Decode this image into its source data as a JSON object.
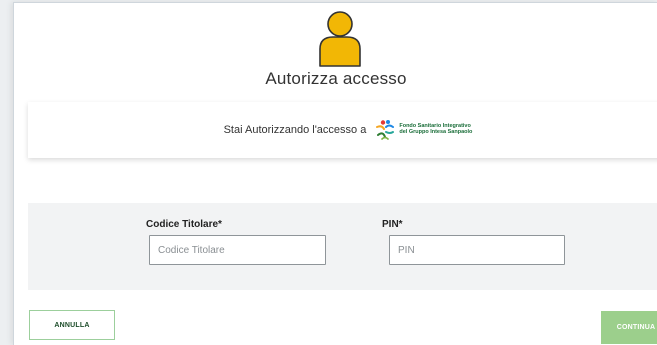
{
  "header": {
    "title": "Autorizza accesso"
  },
  "auth_card": {
    "text": "Stai Autorizzando l'accesso a",
    "logo_line1": "Fondo Sanitario Integrativo",
    "logo_line2": "del Gruppo Intesa Sanpaolo"
  },
  "form": {
    "codice_label": "Codice Titolare*",
    "codice_placeholder": "Codice Titolare",
    "codice_value": "",
    "pin_label": "PIN*",
    "pin_placeholder": "PIN",
    "pin_value": ""
  },
  "buttons": {
    "annulla": "ANNULLA",
    "continua": "CONTINUA"
  },
  "colors": {
    "avatar_head_fill": "#f2b705",
    "avatar_outline": "#333333",
    "continua_bg": "#9ccf8c",
    "annulla_border": "#9ccf9c"
  },
  "icons": {
    "avatar": "user-avatar-icon",
    "logo": "fondo-sanitario-logo"
  }
}
